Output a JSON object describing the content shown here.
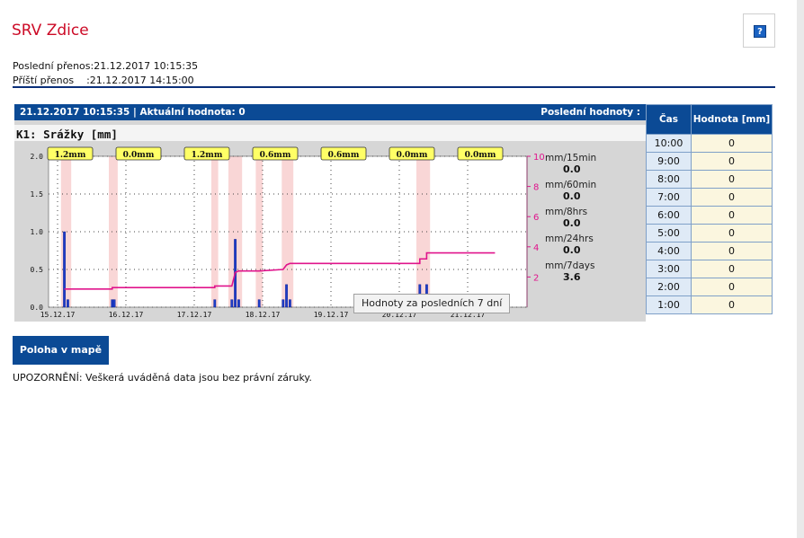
{
  "header": {
    "title": "SRV Zdice",
    "help_label": "?",
    "last_transfer": "Poslední přenos:21.12.2017 10:15:35",
    "next_transfer": "Příští přenos    :21.12.2017 14:15:00"
  },
  "panel": {
    "status": "21.12.2017 10:15:35 | Aktuální hodnota: 0",
    "last_values_label": "Poslední hodnoty :",
    "chart_title": "K1: Srážky [mm]",
    "tooltip": "Hodnoty za posledních 7 dní"
  },
  "stats": [
    {
      "label": "mm/15min",
      "value": "0.0"
    },
    {
      "label": "mm/60min",
      "value": "0.0"
    },
    {
      "label": "mm/8hrs",
      "value": "0.0"
    },
    {
      "label": "mm/24hrs",
      "value": "0.0"
    },
    {
      "label": "mm/7days",
      "value": "3.6"
    }
  ],
  "table": {
    "col_time": "Čas",
    "col_value": "Hodnota [mm]",
    "rows": [
      {
        "time": "10:00",
        "value": "0"
      },
      {
        "time": "9:00",
        "value": "0"
      },
      {
        "time": "8:00",
        "value": "0"
      },
      {
        "time": "7:00",
        "value": "0"
      },
      {
        "time": "6:00",
        "value": "0"
      },
      {
        "time": "5:00",
        "value": "0"
      },
      {
        "time": "4:00",
        "value": "0"
      },
      {
        "time": "3:00",
        "value": "0"
      },
      {
        "time": "2:00",
        "value": "0"
      },
      {
        "time": "1:00",
        "value": "0"
      }
    ]
  },
  "map_button": "Poloha v mapě",
  "notice": "UPOZORNĚNÍ: Veškerá uváděná data jsou bez právní záruky.",
  "colors": {
    "bar": "#1f3ec9",
    "cumulative": "#e0148c",
    "shade": "#f9d6d6",
    "header": "#0b4a95",
    "title": "#cc0a26"
  },
  "chart_data": {
    "type": "bar",
    "x_ticks": [
      "15.12.17",
      "16.12.17",
      "17.12.17",
      "18.12.17",
      "19.12.17",
      "20.12.17",
      "21.12.17"
    ],
    "ylim": [
      0,
      2.0
    ],
    "y_ticks": [
      "0.0",
      "0.5",
      "1.0",
      "1.5",
      "2.0"
    ],
    "y2lim": [
      0,
      10
    ],
    "y2_ticks": [
      "2",
      "4",
      "6",
      "8",
      "10"
    ],
    "day_totals": [
      "1.2mm",
      "0.0mm",
      "1.2mm",
      "0.6mm",
      "0.6mm",
      "0.0mm",
      "0.0mm"
    ],
    "bars": [
      {
        "x": 0.1,
        "value": 1.0
      },
      {
        "x": 0.15,
        "value": 0.1
      },
      {
        "x": 0.8,
        "value": 0.1
      },
      {
        "x": 0.83,
        "value": 0.1
      },
      {
        "x": 2.3,
        "value": 0.1
      },
      {
        "x": 2.55,
        "value": 0.1
      },
      {
        "x": 2.6,
        "value": 0.9
      },
      {
        "x": 2.65,
        "value": 0.1
      },
      {
        "x": 2.95,
        "value": 0.1
      },
      {
        "x": 3.3,
        "value": 0.1
      },
      {
        "x": 3.35,
        "value": 0.3
      },
      {
        "x": 3.4,
        "value": 0.1
      },
      {
        "x": 5.3,
        "value": 0.3
      },
      {
        "x": 5.4,
        "value": 0.3
      }
    ],
    "shaded_spans": [
      [
        0.05,
        0.2
      ],
      [
        0.75,
        0.88
      ],
      [
        2.25,
        2.35
      ],
      [
        2.5,
        2.7
      ],
      [
        2.9,
        3.0
      ],
      [
        3.28,
        3.45
      ],
      [
        5.25,
        5.45
      ]
    ],
    "cumulative": [
      [
        0.1,
        1.2
      ],
      [
        0.8,
        1.2
      ],
      [
        0.8,
        1.3
      ],
      [
        2.3,
        1.3
      ],
      [
        2.3,
        1.4
      ],
      [
        2.55,
        1.4
      ],
      [
        2.6,
        2.3
      ],
      [
        2.65,
        2.4
      ],
      [
        2.95,
        2.4
      ],
      [
        3.3,
        2.5
      ],
      [
        3.35,
        2.8
      ],
      [
        3.4,
        2.9
      ],
      [
        5.3,
        2.9
      ],
      [
        5.3,
        3.2
      ],
      [
        5.4,
        3.2
      ],
      [
        5.4,
        3.6
      ],
      [
        6.4,
        3.6
      ]
    ]
  }
}
